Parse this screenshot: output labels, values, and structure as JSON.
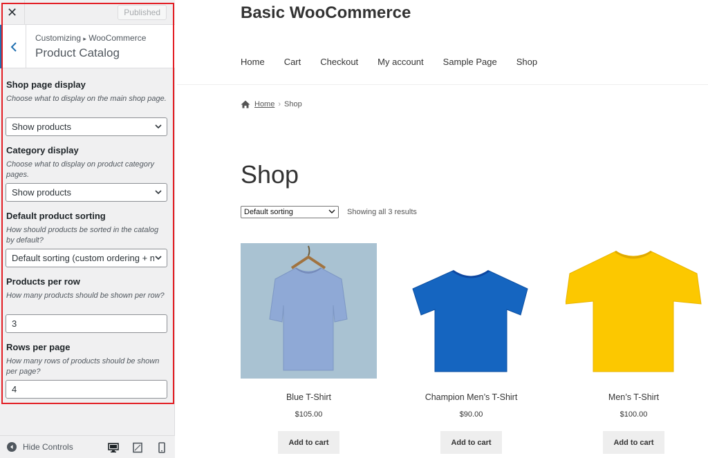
{
  "customizer": {
    "close_glyph": "✕",
    "publish_label": "Published",
    "breadcrumb_prefix": "Customizing",
    "breadcrumb_sep": "▸",
    "breadcrumb_section": "WooCommerce",
    "section_title": "Product Catalog",
    "controls": {
      "shop_display": {
        "label": "Shop page display",
        "description": "Choose what to display on the main shop page.",
        "value": "Show products"
      },
      "category_display": {
        "label": "Category display",
        "description": "Choose what to display on product category pages.",
        "value": "Show products"
      },
      "default_sorting": {
        "label": "Default product sorting",
        "description": "How should products be sorted in the catalog by default?",
        "value": "Default sorting (custom ordering + na"
      },
      "products_per_row": {
        "label": "Products per row",
        "description": "How many products should be shown per row?",
        "value": "3"
      },
      "rows_per_page": {
        "label": "Rows per page",
        "description": "How many rows of products should be shown per page?",
        "value": "4"
      }
    },
    "footer": {
      "hide_controls_label": "Hide Controls",
      "devices": [
        "desktop-icon",
        "tablet-icon",
        "mobile-icon"
      ]
    },
    "highlight_color": "#e31e24",
    "accent_color": "#2271b1"
  },
  "site": {
    "title": "Basic WooCommerce",
    "nav": [
      "Home",
      "Cart",
      "Checkout",
      "My account",
      "Sample Page",
      "Shop"
    ],
    "breadcrumb": {
      "home": "Home",
      "current": "Shop"
    },
    "page_title": "Shop",
    "sorting_value": "Default sorting",
    "result_count": "Showing all 3 results",
    "products": [
      {
        "name": "Blue T-Shirt",
        "price": "$105.00",
        "button": "Add to cart",
        "color": "#8fa9d6"
      },
      {
        "name": "Champion Men’s T-Shirt",
        "price": "$90.00",
        "button": "Add to cart",
        "color": "#1565c0"
      },
      {
        "name": "Men’s T-Shirt",
        "price": "$100.00",
        "button": "Add to cart",
        "color": "#fcc800"
      }
    ]
  }
}
